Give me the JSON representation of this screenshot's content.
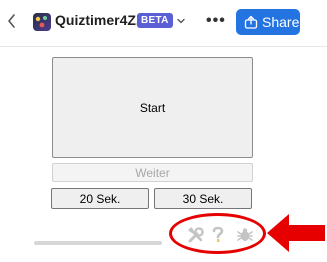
{
  "header": {
    "app_title": "Quiztimer4Z...",
    "badge": "BETA",
    "more_label": "•••",
    "share_label": "Share"
  },
  "main": {
    "start_label": "Start",
    "next_label": "Weiter",
    "timer_buttons": [
      "20 Sek.",
      "30 Sek."
    ]
  },
  "toolbar": {
    "icons": [
      "wrench-icon",
      "help-icon",
      "bug-icon"
    ]
  },
  "annotation": {
    "highlight_color": "#e60000"
  },
  "colors": {
    "share_button": "#2374e1",
    "beta_badge": "#5b5fd6"
  }
}
